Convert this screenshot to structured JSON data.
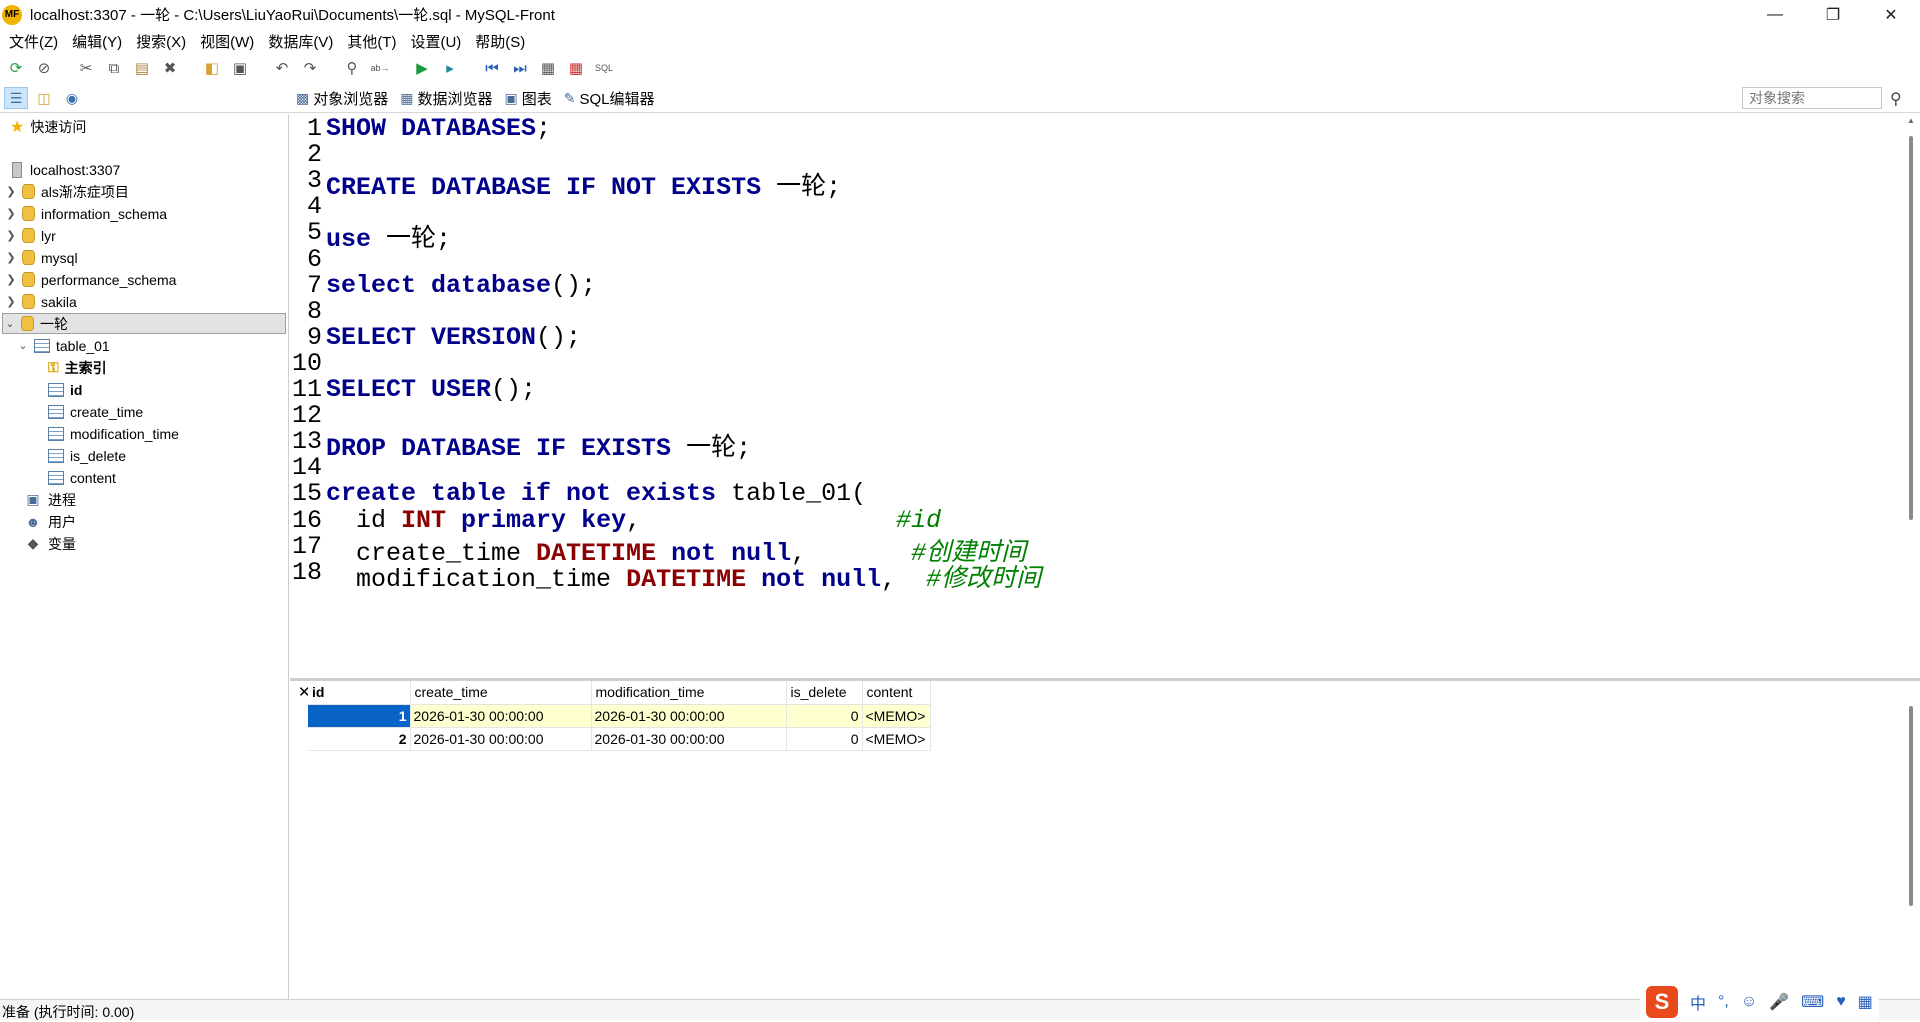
{
  "window": {
    "app_icon": "MF",
    "title": "localhost:3307 - 一轮 - C:\\Users\\LiuYaoRui\\Documents\\一轮.sql - MySQL-Front",
    "controls": [
      "minimize-icon",
      "restore-icon",
      "close-icon"
    ]
  },
  "menu": [
    "文件(Z)",
    "编辑(Y)",
    "搜索(X)",
    "视图(W)",
    "数据库(V)",
    "其他(T)",
    "设置(U)",
    "帮助(S)"
  ],
  "toolbar_icons": [
    "refresh-icon",
    "stop-icon",
    "cut-icon",
    "copy-icon",
    "paste-icon",
    "delete-icon",
    "open-icon",
    "save-icon",
    "undo-icon",
    "redo-icon",
    "find-icon",
    "replace-icon",
    "run-icon",
    "run-selection-icon",
    "first-icon",
    "last-icon",
    "post-icon",
    "cancel-icon",
    "sql-check-icon"
  ],
  "view_tabs": [
    {
      "label": "对象浏览器",
      "icon": "object-browser-icon"
    },
    {
      "label": "数据浏览器",
      "icon": "data-browser-icon"
    },
    {
      "label": "图表",
      "icon": "diagram-icon"
    },
    {
      "label": "SQL编辑器",
      "icon": "sql-editor-icon"
    }
  ],
  "search": {
    "placeholder": "对象搜索"
  },
  "sidebar": {
    "quick_access": "快速访问",
    "host": "localhost:3307",
    "databases": [
      "als渐冻症项目",
      "information_schema",
      "lyr",
      "mysql",
      "performance_schema",
      "sakila",
      "一轮"
    ],
    "selected_db": "一轮",
    "table": "table_01",
    "primary_index": "主索引",
    "columns": [
      "id",
      "create_time",
      "modification_time",
      "is_delete",
      "content"
    ],
    "extras": [
      "进程",
      "用户",
      "变量"
    ]
  },
  "editor": {
    "lines": [
      {
        "n": "1",
        "code": [
          [
            "kw",
            "SHOW DATABASES"
          ],
          [
            "",
            ";"
          ]
        ]
      },
      {
        "n": "2",
        "code": []
      },
      {
        "n": "3",
        "code": [
          [
            "kw",
            "CREATE DATABASE IF NOT EXISTS "
          ],
          [
            "cjk",
            "一轮"
          ],
          [
            "",
            ";"
          ]
        ]
      },
      {
        "n": "4",
        "code": []
      },
      {
        "n": "5",
        "code": [
          [
            "kw",
            "use "
          ],
          [
            "cjk",
            "一轮"
          ],
          [
            "",
            ";"
          ]
        ]
      },
      {
        "n": "6",
        "code": []
      },
      {
        "n": "7",
        "code": [
          [
            "kw",
            "select database"
          ],
          [
            "",
            "();"
          ]
        ]
      },
      {
        "n": "8",
        "code": []
      },
      {
        "n": "9",
        "code": [
          [
            "kw",
            "SELECT VERSION"
          ],
          [
            "",
            "();"
          ]
        ]
      },
      {
        "n": "10",
        "code": []
      },
      {
        "n": "11",
        "code": [
          [
            "kw",
            "SELECT USER"
          ],
          [
            "",
            "();"
          ]
        ]
      },
      {
        "n": "12",
        "code": []
      },
      {
        "n": "13",
        "code": [
          [
            "kw",
            "DROP DATABASE IF EXISTS "
          ],
          [
            "cjk",
            "一轮"
          ],
          [
            "",
            ";"
          ]
        ]
      },
      {
        "n": "14",
        "code": []
      },
      {
        "n": "15",
        "code": [
          [
            "kw",
            "create table if not exists "
          ],
          [
            "",
            "table_01("
          ]
        ]
      },
      {
        "n": "16",
        "code": [
          [
            "",
            "  id "
          ],
          [
            "kw2",
            "INT"
          ],
          [
            "",
            " "
          ],
          [
            "kw",
            "primary key"
          ],
          [
            "",
            ",                 "
          ],
          [
            "cmt",
            "#id"
          ]
        ]
      },
      {
        "n": "17",
        "code": [
          [
            "",
            "  create_time "
          ],
          [
            "kw2",
            "DATETIME"
          ],
          [
            "",
            " "
          ],
          [
            "kw",
            "not null"
          ],
          [
            "",
            ",       "
          ],
          [
            "cmt",
            "#创建时间"
          ]
        ]
      },
      {
        "n": "18",
        "code": [
          [
            "",
            "  modification_time "
          ],
          [
            "kw2",
            "DATETIME"
          ],
          [
            "",
            " "
          ],
          [
            "kw",
            "not null"
          ],
          [
            "",
            ",  "
          ],
          [
            "cmt",
            "#修改时间"
          ]
        ]
      }
    ]
  },
  "results": {
    "headers": [
      "id",
      "create_time",
      "modification_time",
      "is_delete",
      "content"
    ],
    "rows": [
      [
        "1",
        "2026-01-30 00:00:00",
        "2026-01-30 00:00:00",
        "0",
        "<MEMO>"
      ],
      [
        "2",
        "2026-01-30 00:00:00",
        "2026-01-30 00:00:00",
        "0",
        "<MEMO>"
      ]
    ]
  },
  "status": {
    "text": "准备 (执行时间: 0.00)"
  },
  "ime": {
    "lang": "中",
    "punct": "°,"
  }
}
